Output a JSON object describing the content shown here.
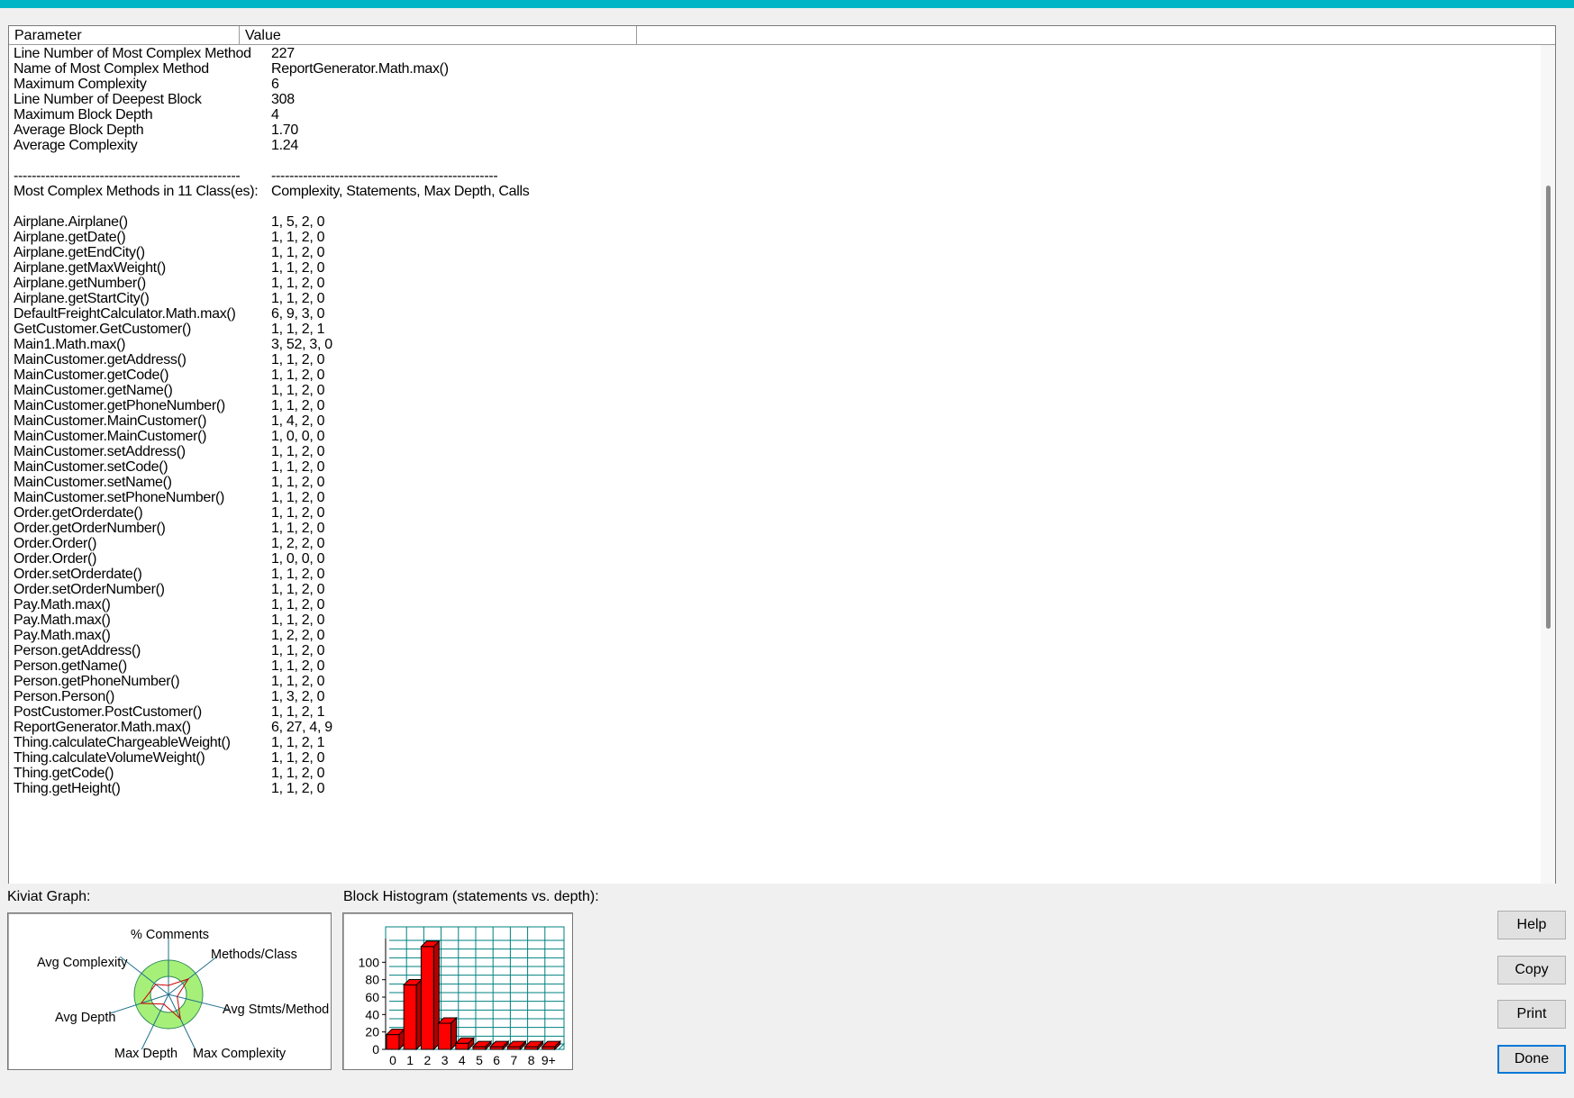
{
  "table": {
    "col_parameter": "Parameter",
    "col_value": "Value",
    "rows": [
      {
        "param": "Line Number of Most Complex Method",
        "value": "227"
      },
      {
        "param": "Name of Most Complex Method",
        "value": "ReportGenerator.Math.max()"
      },
      {
        "param": "Maximum Complexity",
        "value": "6"
      },
      {
        "param": "Line Number of Deepest Block",
        "value": "308"
      },
      {
        "param": "Maximum Block Depth",
        "value": "4"
      },
      {
        "param": "Average Block Depth",
        "value": "1.70"
      },
      {
        "param": "Average Complexity",
        "value": "1.24"
      },
      {
        "param": "",
        "value": ""
      },
      {
        "param": "--------------------------------------------------",
        "value": "--------------------------------------------------"
      },
      {
        "param": "Most Complex Methods in 11 Class(es):",
        "value": "Complexity, Statements, Max Depth, Calls"
      },
      {
        "param": "",
        "value": ""
      },
      {
        "param": "Airplane.Airplane()",
        "value": "1, 5, 2, 0"
      },
      {
        "param": "Airplane.getDate()",
        "value": "1, 1, 2, 0"
      },
      {
        "param": "Airplane.getEndCity()",
        "value": "1, 1, 2, 0"
      },
      {
        "param": "Airplane.getMaxWeight()",
        "value": "1, 1, 2, 0"
      },
      {
        "param": "Airplane.getNumber()",
        "value": "1, 1, 2, 0"
      },
      {
        "param": "Airplane.getStartCity()",
        "value": "1, 1, 2, 0"
      },
      {
        "param": "DefaultFreightCalculator.Math.max()",
        "value": "6, 9, 3, 0"
      },
      {
        "param": "GetCustomer.GetCustomer()",
        "value": "1, 1, 2, 1"
      },
      {
        "param": "Main1.Math.max()",
        "value": "3, 52, 3, 0"
      },
      {
        "param": "MainCustomer.getAddress()",
        "value": "1, 1, 2, 0"
      },
      {
        "param": "MainCustomer.getCode()",
        "value": "1, 1, 2, 0"
      },
      {
        "param": "MainCustomer.getName()",
        "value": "1, 1, 2, 0"
      },
      {
        "param": "MainCustomer.getPhoneNumber()",
        "value": "1, 1, 2, 0"
      },
      {
        "param": "MainCustomer.MainCustomer()",
        "value": "1, 4, 2, 0"
      },
      {
        "param": "MainCustomer.MainCustomer()",
        "value": "1, 0, 0, 0"
      },
      {
        "param": "MainCustomer.setAddress()",
        "value": "1, 1, 2, 0"
      },
      {
        "param": "MainCustomer.setCode()",
        "value": "1, 1, 2, 0"
      },
      {
        "param": "MainCustomer.setName()",
        "value": "1, 1, 2, 0"
      },
      {
        "param": "MainCustomer.setPhoneNumber()",
        "value": "1, 1, 2, 0"
      },
      {
        "param": "Order.getOrderdate()",
        "value": "1, 1, 2, 0"
      },
      {
        "param": "Order.getOrderNumber()",
        "value": "1, 1, 2, 0"
      },
      {
        "param": "Order.Order()",
        "value": "1, 2, 2, 0"
      },
      {
        "param": "Order.Order()",
        "value": "1, 0, 0, 0"
      },
      {
        "param": "Order.setOrderdate()",
        "value": "1, 1, 2, 0"
      },
      {
        "param": "Order.setOrderNumber()",
        "value": "1, 1, 2, 0"
      },
      {
        "param": "Pay.Math.max()",
        "value": "1, 1, 2, 0"
      },
      {
        "param": "Pay.Math.max()",
        "value": "1, 1, 2, 0"
      },
      {
        "param": "Pay.Math.max()",
        "value": "1, 2, 2, 0"
      },
      {
        "param": "Person.getAddress()",
        "value": "1, 1, 2, 0"
      },
      {
        "param": "Person.getName()",
        "value": "1, 1, 2, 0"
      },
      {
        "param": "Person.getPhoneNumber()",
        "value": "1, 1, 2, 0"
      },
      {
        "param": "Person.Person()",
        "value": "1, 3, 2, 0"
      },
      {
        "param": "PostCustomer.PostCustomer()",
        "value": "1, 1, 2, 1"
      },
      {
        "param": "ReportGenerator.Math.max()",
        "value": "6, 27, 4, 9"
      },
      {
        "param": "Thing.calculateChargeableWeight()",
        "value": "1, 1, 2, 1"
      },
      {
        "param": "Thing.calculateVolumeWeight()",
        "value": "1, 1, 2, 0"
      },
      {
        "param": "Thing.getCode()",
        "value": "1, 1, 2, 0"
      },
      {
        "param": "Thing.getHeight()",
        "value": "1, 1, 2, 0"
      }
    ]
  },
  "kiviat": {
    "label": "Kiviat Graph:",
    "axes": [
      "% Comments",
      "Methods/Class",
      "Avg Stmts/Method",
      "Max Complexity",
      "Max Depth",
      "Avg Depth",
      "Avg Complexity"
    ]
  },
  "histogram": {
    "label": "Block Histogram (statements vs. depth):"
  },
  "chart_data": {
    "type": "bar",
    "categories": [
      "0",
      "1",
      "2",
      "3",
      "4",
      "5",
      "6",
      "7",
      "8",
      "9+"
    ],
    "values": [
      17,
      74,
      118,
      30,
      7,
      3,
      3,
      3,
      3,
      3
    ],
    "yticks": [
      0,
      20,
      40,
      60,
      80,
      100
    ],
    "ylim": [
      0,
      120
    ],
    "bar_color": "#ff0000",
    "grid_color": "#008080",
    "grid": true
  },
  "buttons": {
    "help": "Help",
    "copy": "Copy",
    "print": "Print",
    "done": "Done"
  },
  "colors": {
    "title_bar": "#00b6c6",
    "accent": "#0078d7"
  }
}
